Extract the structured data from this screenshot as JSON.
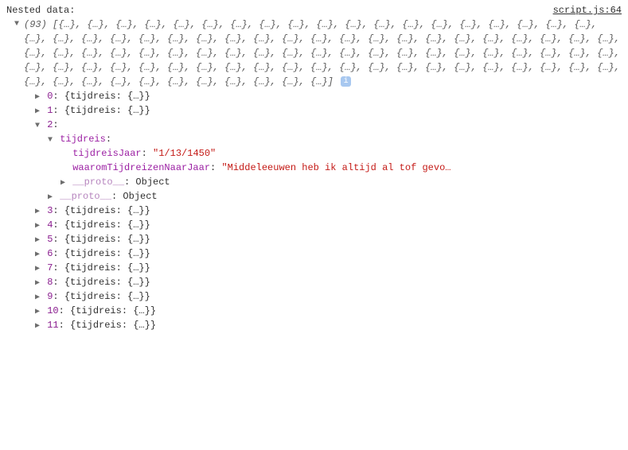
{
  "header": {
    "label": "Nested data:",
    "source": "script.js:64"
  },
  "summary": {
    "count": "(93)",
    "body": "[{…}, {…}, {…}, {…}, {…}, {…}, {…}, {…}, {…}, {…}, {…}, {…}, {…}, {…}, {…}, {…}, {…}, {…}, {…}, {…}, {…}, {…}, {…}, {…}, {…}, {…}, {…}, {…}, {…}, {…}, {…}, {…}, {…}, {…}, {…}, {…}, {…}, {…}, {…}, {…}, {…}, {…}, {…}, {…}, {…}, {…}, {…}, {…}, {…}, {…}, {…}, {…}, {…}, {…}, {…}, {…}, {…}, {…}, {…}, {…}, {…}, {…}, {…}, {…}, {…}, {…}, {…}, {…}, {…}, {…}, {…}, {…}, {…}, {…}, {…}, {…}, {…}, {…}, {…}, {…}, {…}, {…}, {…}, {…}, {…}, {…}, {…}, {…}, {…}, {…}, {…}, {…}, {…}]",
    "info": "i"
  },
  "entries": {
    "e0": {
      "idx": "0",
      "preview": "{tijdreis: {…}}"
    },
    "e1": {
      "idx": "1",
      "preview": "{tijdreis: {…}}"
    },
    "e2": {
      "idx": "2",
      "propName": "tijdreis",
      "fields": {
        "jaarKey": "tijdreisJaar",
        "jaarVal": "\"1/13/1450\"",
        "waaromKey": "waaromTijdreizenNaarJaar",
        "waaromVal": "\"Middeleeuwen heb ik altijd al tof gevo…"
      },
      "protoKey": "__proto__",
      "protoVal": "Object"
    },
    "e3": {
      "idx": "3",
      "preview": "{tijdreis: {…}}"
    },
    "e4": {
      "idx": "4",
      "preview": "{tijdreis: {…}}"
    },
    "e5": {
      "idx": "5",
      "preview": "{tijdreis: {…}}"
    },
    "e6": {
      "idx": "6",
      "preview": "{tijdreis: {…}}"
    },
    "e7": {
      "idx": "7",
      "preview": "{tijdreis: {…}}"
    },
    "e8": {
      "idx": "8",
      "preview": "{tijdreis: {…}}"
    },
    "e9": {
      "idx": "9",
      "preview": "{tijdreis: {…}}"
    },
    "e10": {
      "idx": "10",
      "preview": "{tijdreis: {…}}"
    },
    "e11": {
      "idx": "11",
      "preview": "{tijdreis: {…}}"
    }
  },
  "glyphs": {
    "collapsed": "▶",
    "expanded": "▼"
  }
}
